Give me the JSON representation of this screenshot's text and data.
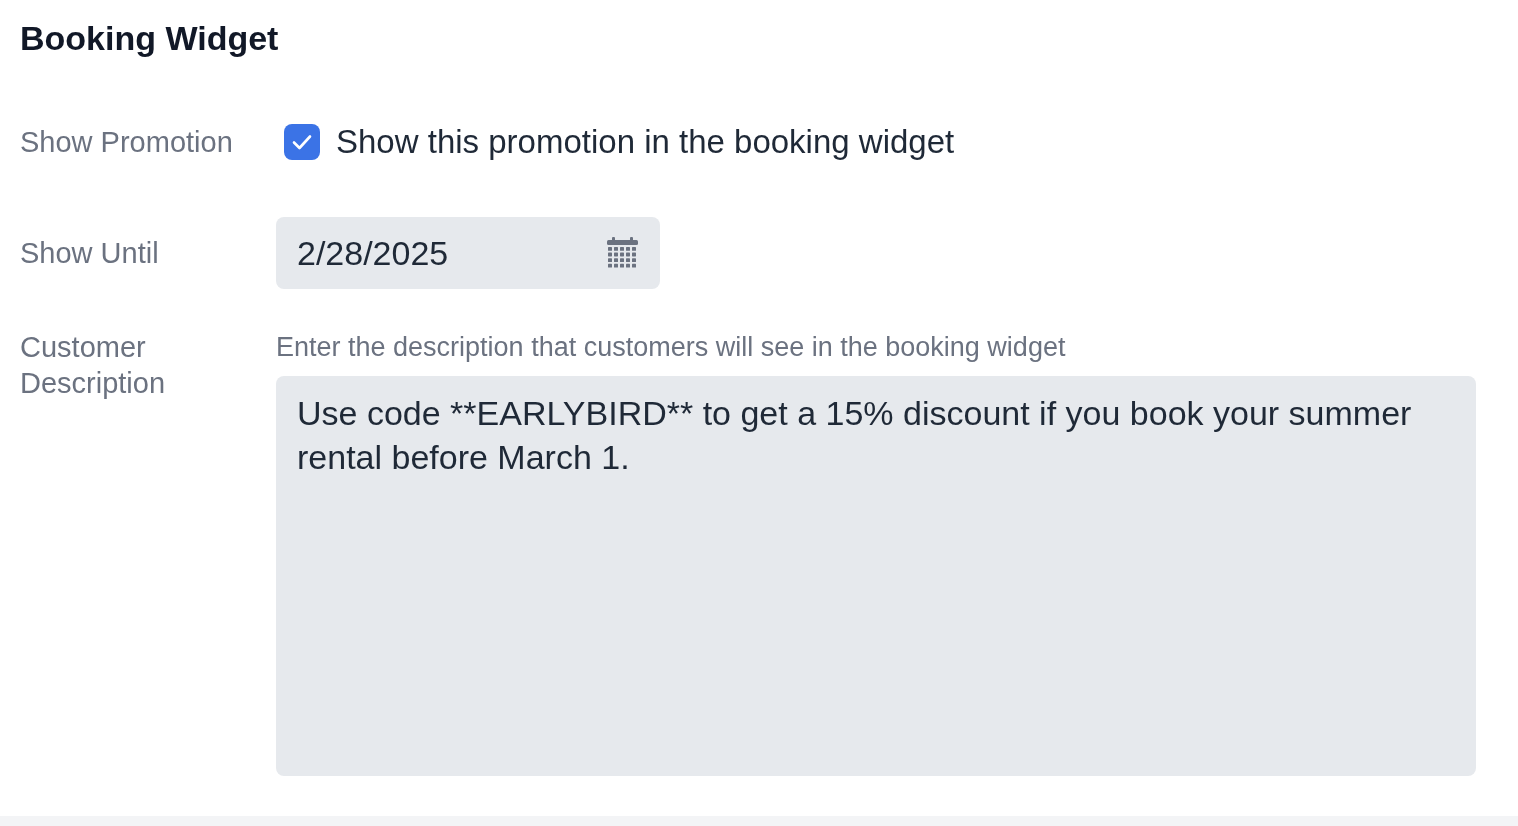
{
  "section": {
    "title": "Booking Widget"
  },
  "fields": [
    {
      "kind": "checkbox",
      "label": "Show Promotion",
      "checked": true,
      "option_label": "Show this promotion in the booking widget"
    },
    {
      "kind": "date",
      "label": "Show Until",
      "value": "2/28/2025"
    },
    {
      "kind": "textarea",
      "label": "Customer Description",
      "hint": "Enter the description that customers will see in the booking widget",
      "value": "Use code **EARLYBIRD** to get a 15% discount if you book your summer rental before March 1."
    }
  ]
}
